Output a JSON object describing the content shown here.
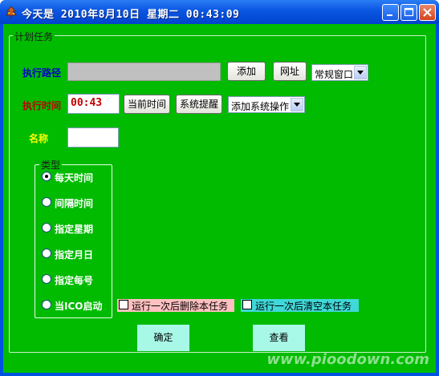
{
  "window": {
    "title": "今天是 2010年8月10日 星期二 00:43:09"
  },
  "group": {
    "label": "计划任务"
  },
  "path": {
    "label": "执行路径",
    "value": "",
    "add_label": "添加",
    "url_label": "网址",
    "window_mode": "常规窗口"
  },
  "time": {
    "label": "执行时间",
    "value": "00:43",
    "current_label": "当前时间",
    "reminder_label": "系统提醒",
    "system_action": "添加系统操作"
  },
  "name": {
    "label": "名称",
    "value": ""
  },
  "type_group": {
    "label": "类型",
    "options": [
      "每天时间",
      "间隔时间",
      "指定星期",
      "指定月日",
      "指定每号",
      "当ICO启动"
    ],
    "selected_index": 0
  },
  "checks": {
    "delete_after_run": "运行一次后删除本任务",
    "clear_after_run": "运行一次后清空本任务"
  },
  "buttons": {
    "ok_label": "确定",
    "view_label": "查看"
  },
  "watermark": "www.pioodown.com",
  "colors": {
    "background": "#00bb00",
    "path_label": "#0000cc",
    "time_label": "#c00000",
    "name_label": "#ffff00",
    "time_value": "#c00000",
    "check1_bg": "#ffc0c0",
    "check2_bg": "#40d8d8",
    "big_button_bg": "#a8f8e8"
  },
  "icons": {
    "app": "tree-icon",
    "minimize": "minimize-icon",
    "maximize": "maximize-icon",
    "close": "close-icon"
  }
}
